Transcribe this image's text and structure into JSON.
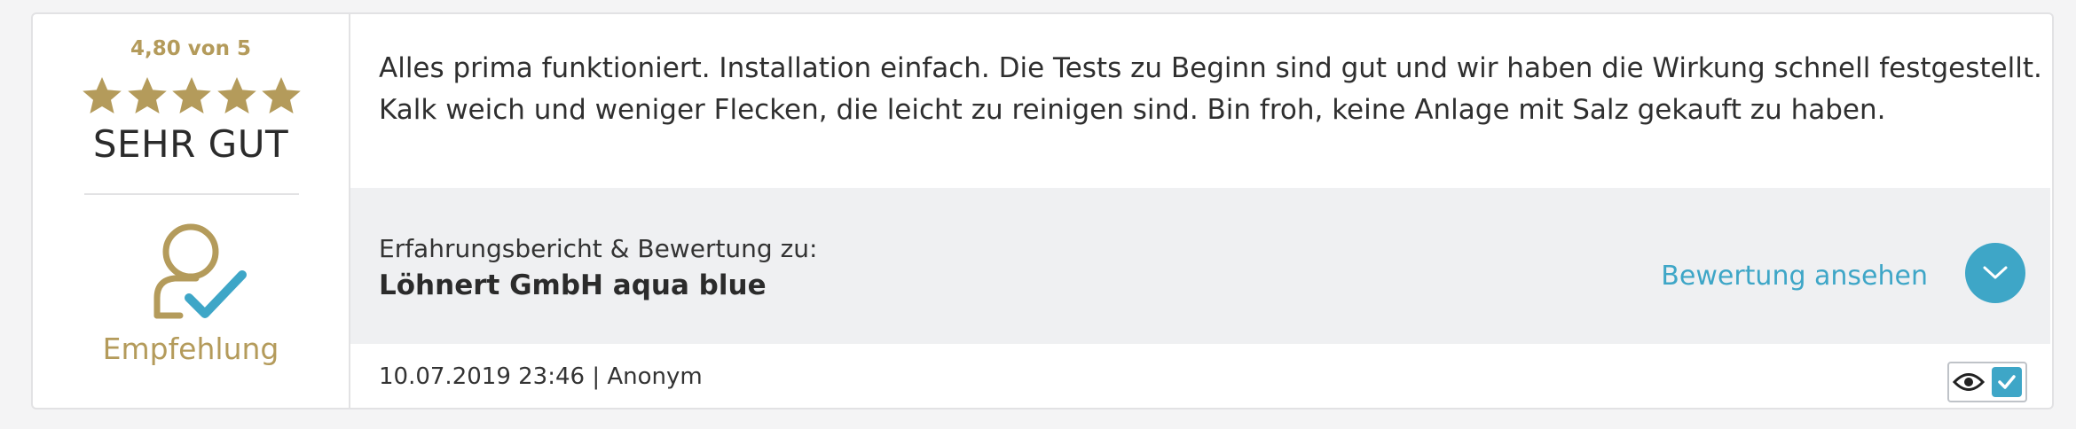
{
  "rating": {
    "score_text": "4,80 von 5",
    "stars": 5,
    "verdict": "SEHR GUT",
    "recommendation_label": "Empfehlung",
    "accent_color": "#b49b5b"
  },
  "review": {
    "lines": [
      "Alles prima funktioniert. Installation einfach. Die Tests zu Beginn sind gut und wir haben die Wirkung schnell festgestellt.",
      "Kalk weich und weniger Flecken, die leicht zu reinigen sind. Bin froh, keine Anlage mit Salz gekauft zu haben."
    ],
    "about_label": "Erfahrungsbericht & Bewertung zu:",
    "product_name": "Löhnert GmbH aqua blue",
    "view_link": "Bewertung ansehen",
    "meta": "10.07.2019 23:46 | Anonym",
    "link_color": "#3ea6c7"
  },
  "icons": [
    "star-icon",
    "user-check-icon",
    "chevron-down-icon",
    "eye-icon",
    "checkmark-icon"
  ]
}
